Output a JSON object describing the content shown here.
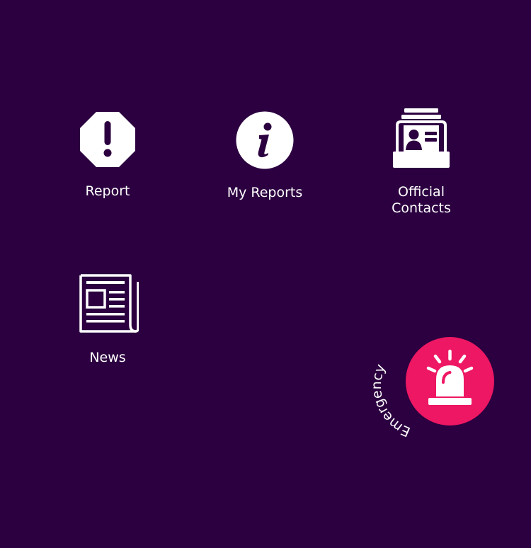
{
  "colors": {
    "background": "#2c0040",
    "foreground": "#ffffff",
    "emergency_accent": "#ee1763"
  },
  "menu": {
    "items": [
      {
        "key": "report",
        "label": "Report",
        "icon": "octagon-exclamation-icon"
      },
      {
        "key": "my_reports",
        "label": "My Reports",
        "icon": "info-circle-icon"
      },
      {
        "key": "official_contacts",
        "label": "Official\nContacts",
        "icon": "contact-card-file-icon"
      },
      {
        "key": "news",
        "label": "News",
        "icon": "newspaper-icon"
      }
    ]
  },
  "emergency": {
    "label": "Emergency",
    "icon": "siren-icon"
  }
}
